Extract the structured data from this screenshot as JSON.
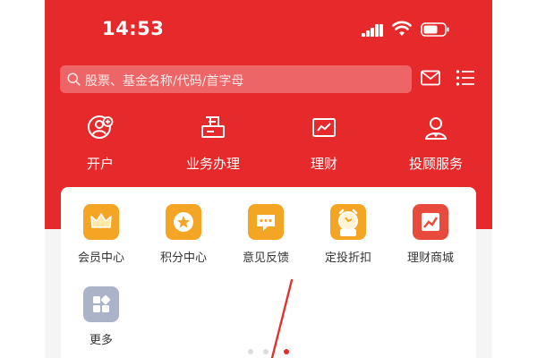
{
  "status_bar": {
    "time": "14:53"
  },
  "search": {
    "placeholder": "股票、基金名称/代码/首字母"
  },
  "quick_actions": [
    {
      "label": "开户",
      "icon": "account-open-icon"
    },
    {
      "label": "业务办理",
      "icon": "business-handling-icon"
    },
    {
      "label": "理财",
      "icon": "wealth-chart-icon"
    },
    {
      "label": "投顾服务",
      "icon": "advisor-icon"
    }
  ],
  "services": [
    {
      "label": "会员中心",
      "icon": "crown-icon",
      "color": "#f5a524"
    },
    {
      "label": "积分中心",
      "icon": "star-badge-icon",
      "color": "#f5a524"
    },
    {
      "label": "意见反馈",
      "icon": "chat-bubble-icon",
      "color": "#f5a524"
    },
    {
      "label": "定投折扣",
      "icon": "alarm-clock-discount-icon",
      "color": "#f5a524"
    },
    {
      "label": "理财商城",
      "icon": "trend-chart-icon",
      "color": "#e84a3e"
    },
    {
      "label": "更多",
      "icon": "grid-more-icon",
      "color": "#aab3c8"
    }
  ],
  "pager": {
    "pages": 3,
    "active_page": 3
  },
  "colors": {
    "brand_red": "#e62a2c",
    "card_bg": "#ffffff",
    "page_bg": "#f5f5f5",
    "text": "#333333"
  }
}
